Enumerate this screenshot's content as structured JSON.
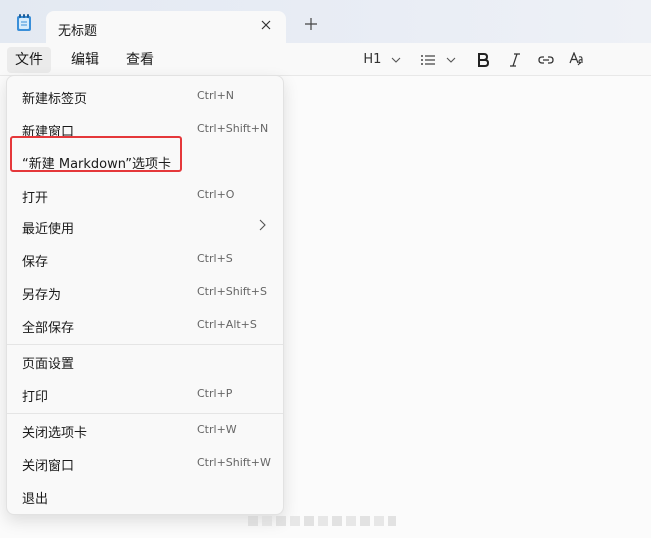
{
  "tab": {
    "title": "无标题",
    "close_icon": "close-icon",
    "new_tab_icon": "plus-icon"
  },
  "menubar": {
    "items": [
      "文件",
      "编辑",
      "查看"
    ]
  },
  "toolbar": {
    "heading_label": "H1",
    "icons": [
      "chevron-down-icon",
      "list-icon",
      "bold-icon",
      "italic-icon",
      "link-icon",
      "spellcheck-icon"
    ]
  },
  "dropdown": {
    "items": [
      {
        "label": "新建标签页",
        "shortcut": "Ctrl+N"
      },
      {
        "label": "新建窗口",
        "shortcut": "Ctrl+Shift+N"
      },
      {
        "label": "“新建 Markdown”选项卡",
        "shortcut": ""
      },
      {
        "label": "打开",
        "shortcut": "Ctrl+O"
      },
      {
        "label": "最近使用",
        "shortcut": ""
      },
      {
        "label": "保存",
        "shortcut": "Ctrl+S"
      },
      {
        "label": "另存为",
        "shortcut": "Ctrl+Shift+S"
      },
      {
        "label": "全部保存",
        "shortcut": "Ctrl+Alt+S"
      },
      {
        "label": "页面设置",
        "shortcut": ""
      },
      {
        "label": "打印",
        "shortcut": "Ctrl+P"
      },
      {
        "label": "关闭选项卡",
        "shortcut": "Ctrl+W"
      },
      {
        "label": "关闭窗口",
        "shortcut": "Ctrl+Shift+W"
      },
      {
        "label": "退出",
        "shortcut": ""
      }
    ]
  },
  "colors": {
    "highlight_border": "#e5383b",
    "tabbar_bg": "#e6ebf3",
    "menu_bg": "#f9f9f9"
  }
}
